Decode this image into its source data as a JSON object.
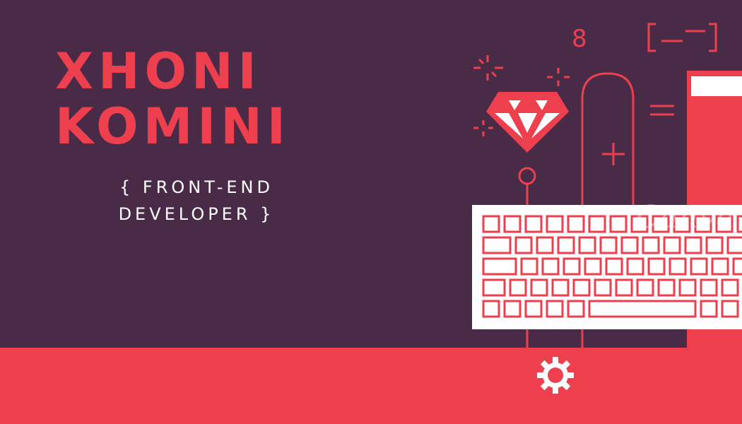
{
  "banner": {
    "name_line1": "XHONI",
    "name_line2": "KOMINI",
    "subtitle_line1": "{ FRONT-END",
    "subtitle_line2": "DEVELOPER }",
    "watermark": "Canva",
    "art_digit": "8"
  },
  "colors": {
    "background": "#4a2b47",
    "accent": "#ee3f4f",
    "text": "#ffffff"
  },
  "icons": [
    "ruby-gem-icon",
    "keyboard-icon",
    "mouse-cable-icon",
    "gear-icon",
    "sparkle-icon",
    "monitor-icon",
    "code-bracket-icon"
  ]
}
